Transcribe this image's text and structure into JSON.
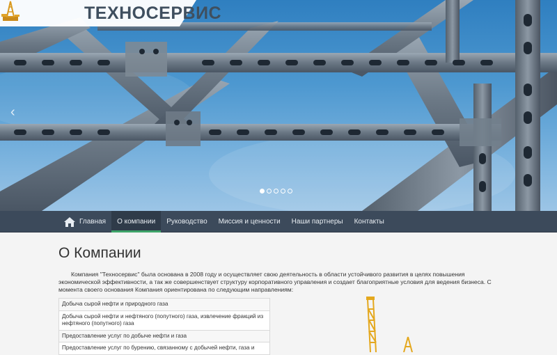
{
  "brand": {
    "name": "ТЕХНОСЕРВИС"
  },
  "slider": {
    "prev_glyph": "‹",
    "dots": [
      true,
      false,
      false,
      false,
      false
    ]
  },
  "nav": {
    "items": [
      {
        "label": "Главная",
        "icon": "home-icon"
      },
      {
        "label": "О компании"
      },
      {
        "label": "Руководство"
      },
      {
        "label": "Миссия и ценности"
      },
      {
        "label": "Наши партнеры"
      },
      {
        "label": "Контакты"
      }
    ]
  },
  "page": {
    "title": "О Компании",
    "intro": "Компания \"Техносервис\" была основана в 2008 году и осуществляет свою деятельность в области устойчивого развития в целях повышения экономической эффективности, а так же совершенствует структуру корпоративного управления и создает благоприятные условия для ведения бизнеса. С момента своего основания Компания ориентирована по следующим направлениям:",
    "directions": [
      "Добыча сырой нефти и природного газа",
      "Добыча сырой нефти и нефтяного (попутного) газа, извлечение фракций из нефтяного (попутного) газа",
      "Предоставление услуг по добыче нефти и газа",
      "Предоставление услуг по бурению, связанному с добычей нефти, газа и"
    ]
  },
  "colors": {
    "navbar": "#3c4a5b",
    "accent": "#3fa46a",
    "sky": "#4d98d0",
    "steel": "#4a5866"
  }
}
